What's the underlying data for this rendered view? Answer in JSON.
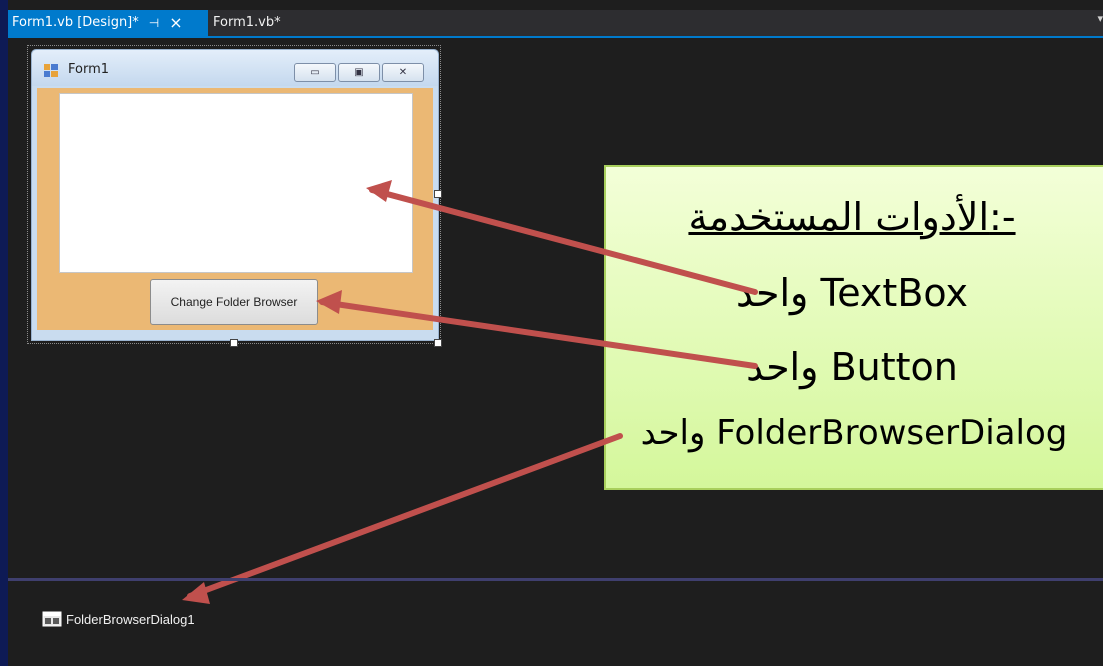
{
  "tabs": {
    "active_label": "Form1.vb [Design]*",
    "pin_glyph": "⊣",
    "close_glyph": "×",
    "inactive_label": "Form1.vb*",
    "dropdown_glyph": "▾"
  },
  "form": {
    "title": "Form1",
    "button_label": "Change Folder Browser",
    "min_glyph": "▭",
    "max_glyph": "▣",
    "close_glyph": "✕"
  },
  "callout": {
    "heading": "الأدوات المستخدمة:-",
    "line1": "واحد TextBox",
    "line2": "واحد Button",
    "line3": "واحد FolderBrowserDialog"
  },
  "tray": {
    "component_label": "FolderBrowserDialog1"
  },
  "colors": {
    "accent": "#007acc",
    "background": "#1e1e1e",
    "form_client": "#ebb874",
    "callout_fill": "#dcf9a8",
    "arrow": "#c0504d"
  }
}
